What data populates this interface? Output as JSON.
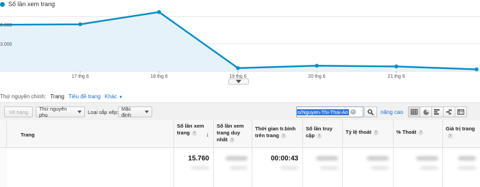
{
  "chart": {
    "legend_label": "Số lần xem trang",
    "y_ticks": [
      "6.000",
      "3.000"
    ],
    "accent_color": "#058dc7",
    "fill_color": "#e6f2fa"
  },
  "chart_data": {
    "type": "area",
    "title": "",
    "series": [
      {
        "name": "Số lần xem trang",
        "values": [
          5100,
          5150,
          6500,
          320,
          580,
          500,
          180
        ]
      }
    ],
    "x_labels": [
      "17 thg 6",
      "18 thg 6",
      "19 thg 6",
      "20 thg 6",
      "21 thg 6"
    ],
    "ylim": [
      0,
      7000
    ],
    "y_ticks": [
      3000,
      6000
    ],
    "grid": true,
    "legend_placement": "top-left"
  },
  "dimension_row": {
    "label": "Thứ nguyên chính:",
    "active": "Trang",
    "link1": "Tiêu đề trang",
    "link2": "Khác"
  },
  "toolbar": {
    "plot_rows": "Vẽ hàng",
    "secondary_dim": "Thứ nguyên phụ",
    "sort_label": "Loại sắp xếp:",
    "sort_value": "Mặc định",
    "search_value": "o/Nguyen-Thi-Thai-An",
    "advanced": "nâng cao"
  },
  "table": {
    "headers": {
      "page": "Trang",
      "pageviews": "Số lần xem trang",
      "unique": "Số lần xem trang duy nhất",
      "avg_time": "Thời gian tr.bình trên trang",
      "entrances": "Số lần truy cập",
      "exit_rate": "Tỷ lệ thoát",
      "pct_exit": "% Thoát",
      "page_value": "Giá trị trang"
    },
    "totals": {
      "pageviews": "15.760",
      "avg_time": "00:00:43"
    }
  }
}
